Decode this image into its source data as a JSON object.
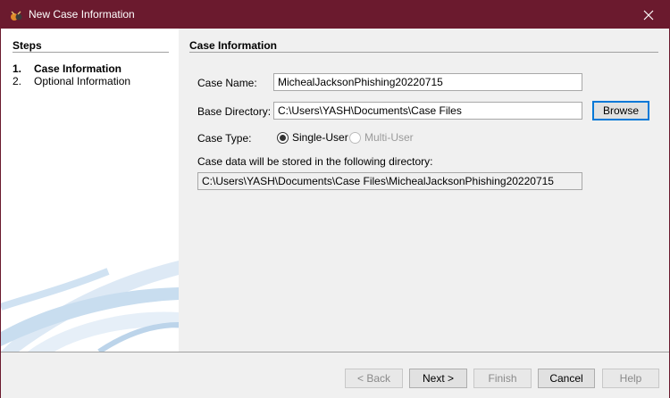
{
  "window": {
    "title": "New Case Information"
  },
  "steps": {
    "title": "Steps",
    "items": [
      {
        "number": "1.",
        "label": "Case Information",
        "active": true
      },
      {
        "number": "2.",
        "label": "Optional Information",
        "active": false
      }
    ]
  },
  "form": {
    "section_title": "Case Information",
    "case_name": {
      "label": "Case Name:",
      "value": "MichealJacksonPhishing20220715"
    },
    "base_directory": {
      "label": "Base Directory:",
      "value": "C:\\Users\\YASH\\Documents\\Case Files",
      "browse_label": "Browse"
    },
    "case_type": {
      "label": "Case Type:",
      "options": [
        {
          "label": "Single-User",
          "selected": true,
          "enabled": true
        },
        {
          "label": "Multi-User",
          "selected": false,
          "enabled": false
        }
      ]
    },
    "storage_note": "Case data will be stored in the following directory:",
    "storage_path": "C:\\Users\\YASH\\Documents\\Case Files\\MichealJacksonPhishing20220715"
  },
  "buttons": {
    "back": "< Back",
    "next": "Next >",
    "finish": "Finish",
    "cancel": "Cancel",
    "help": "Help"
  },
  "colors": {
    "titlebar": "#6b1a2e",
    "focus_border": "#0078d7",
    "art_blue": "#c8ddef"
  }
}
